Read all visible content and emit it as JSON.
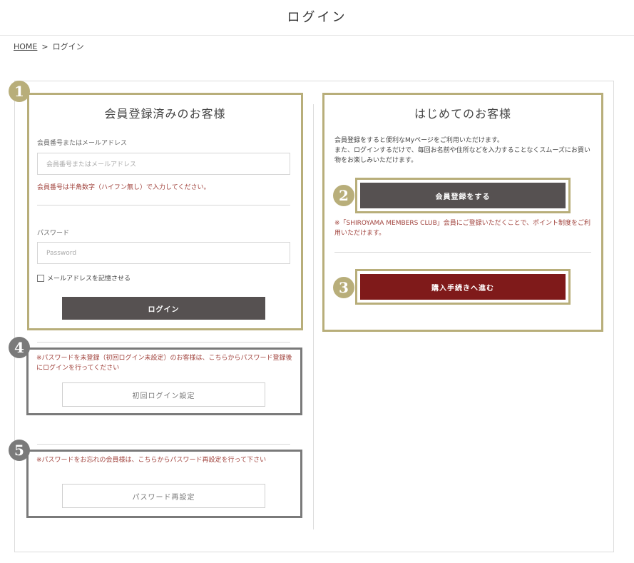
{
  "header": {
    "title": "ログイン"
  },
  "breadcrumb": {
    "home": "HOME",
    "separator": ">",
    "current": "ログイン"
  },
  "member": {
    "title": "会員登録済みのお客様",
    "id_label": "会員番号またはメールアドレス",
    "id_placeholder": "会員番号またはメールアドレス",
    "id_note": "会員番号は半角数字（ハイフン無し）で入力してください。",
    "password_label": "パスワード",
    "password_placeholder": "Password",
    "remember_label": "メールアドレスを記憶させる",
    "login_button": "ログイン"
  },
  "first_login": {
    "note": "※パスワードを未登録（初回ログイン未設定）のお客様は、こちらからパスワード登録後にログインを行ってください",
    "button": "初回ログイン設定"
  },
  "reset": {
    "note": "※パスワードをお忘れの会員様は、こちらからパスワード再設定を行って下さい",
    "button": "パスワード再設定"
  },
  "new_customer": {
    "title": "はじめてのお客様",
    "desc_line1": "会員登録をすると便利なMyページをご利用いただけます。",
    "desc_line2": "また、ログインするだけで、毎回お名前や住所などを入力することなくスムーズにお買い物をお楽しみいただけます。",
    "register_button": "会員登録をする",
    "club_note": "※「SHIROYAMA MEMBERS CLUB」会員にご登録いただくことで、ポイント制度をご利用いただけます。",
    "purchase_button": "購入手続きへ進む"
  },
  "badges": {
    "b1": "1",
    "b2": "2",
    "b3": "3",
    "b4": "4",
    "b5": "5"
  },
  "colors": {
    "gold_highlight": "#b8ae7a",
    "gray_highlight": "#7a7a7a",
    "dark_button": "#565151",
    "red_button": "#7f1a1a",
    "note_red": "#a0413b"
  }
}
